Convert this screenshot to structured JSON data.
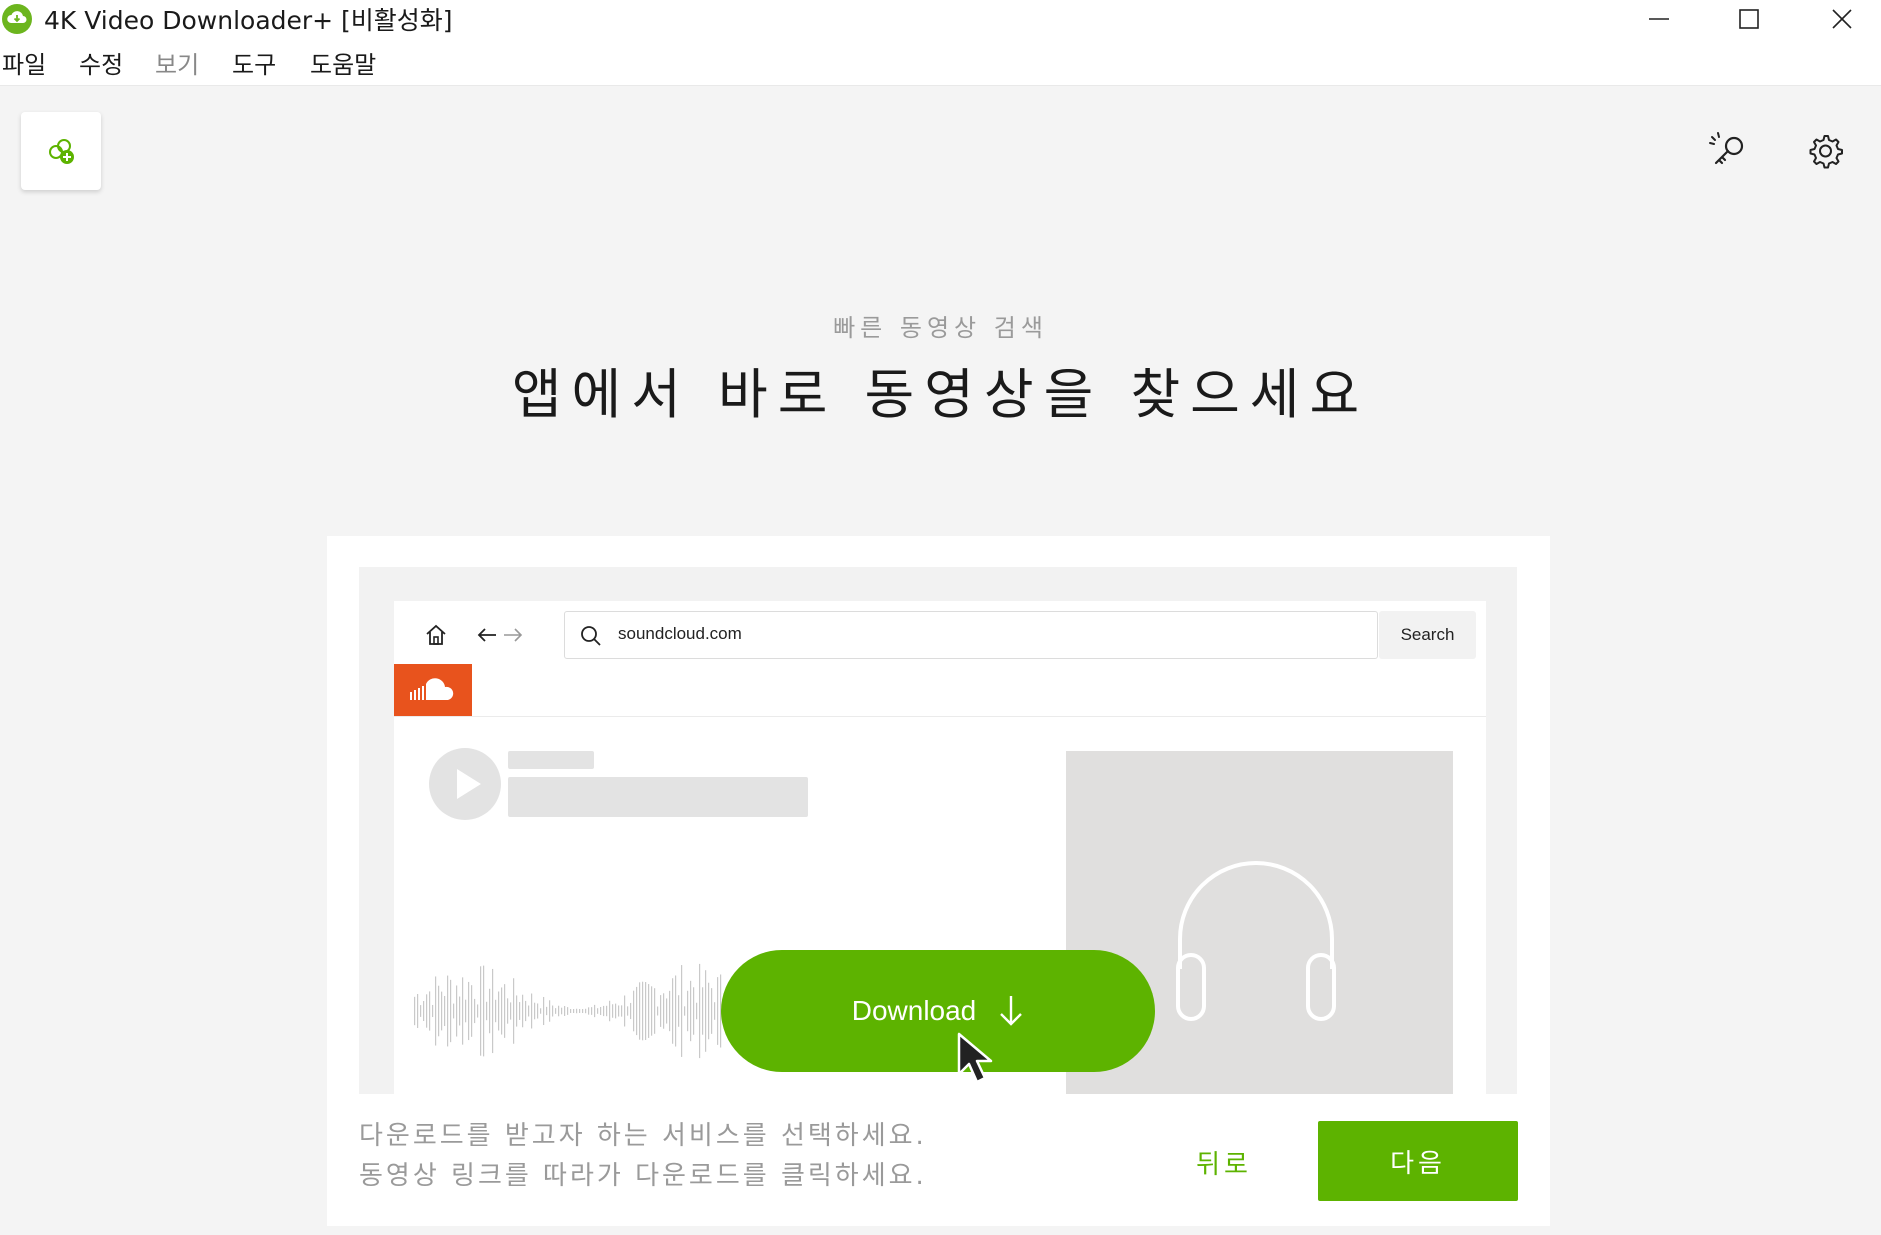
{
  "window": {
    "title": "4K Video Downloader+ [비활성화]",
    "controls": [
      "minimize",
      "maximize",
      "close"
    ]
  },
  "menu": {
    "items": [
      {
        "label": "파일",
        "enabled": true
      },
      {
        "label": "수정",
        "enabled": true
      },
      {
        "label": "보기",
        "enabled": false
      },
      {
        "label": "도구",
        "enabled": true
      },
      {
        "label": "도움말",
        "enabled": true
      }
    ]
  },
  "toolbar": {
    "add_link_icon": "link-plus-icon",
    "license_icon": "magic-key-icon",
    "settings_icon": "gear-icon"
  },
  "onboarding": {
    "subtitle": "빠른 동영상 검색",
    "headline": "앱에서 바로 동영상을 찾으세요",
    "illustration": {
      "url": "soundcloud.com",
      "search_label": "Search",
      "download_label": "Download"
    },
    "hint_lines": [
      "다운로드를 받고자 하는 서비스를 선택하세요.",
      "동영상 링크를 따라가 다운로드를 클릭하세요."
    ],
    "back_label": "뒤로",
    "next_label": "다음"
  },
  "colors": {
    "accent": "#5db300",
    "soundcloud": "#e8531d",
    "background": "#f4f4f4"
  }
}
